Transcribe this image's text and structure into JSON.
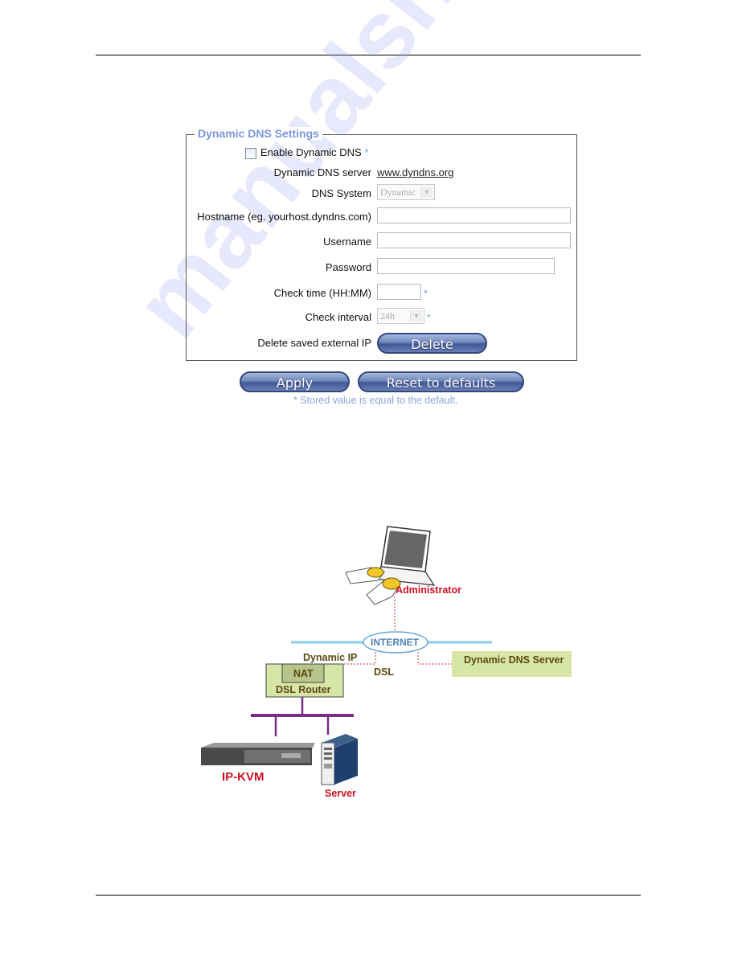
{
  "form": {
    "legend": "Dynamic DNS Settings",
    "enable": {
      "label": "Enable Dynamic DNS",
      "checked": false,
      "marker": "*"
    },
    "server": {
      "label": "Dynamic DNS server",
      "value": "www.dyndns.org"
    },
    "dns_system": {
      "label": "DNS System",
      "selected": "Dynamic",
      "disabled": true
    },
    "hostname": {
      "label": "Hostname (eg. yourhost.dyndns.com)",
      "value": ""
    },
    "username": {
      "label": "Username",
      "value": ""
    },
    "password": {
      "label": "Password",
      "value": ""
    },
    "check_time": {
      "label": "Check time (HH:MM)",
      "value": "",
      "marker": "*"
    },
    "check_interval": {
      "label": "Check interval",
      "selected": "24h",
      "disabled": true,
      "marker": "*"
    },
    "delete_ip": {
      "label": "Delete saved external IP",
      "button": "Delete"
    }
  },
  "actions": {
    "apply": "Apply",
    "reset": "Reset to defaults"
  },
  "note": "* Stored value is equal to the default.",
  "watermark": "manualshive.com",
  "diagram": {
    "administrator": "Administrator",
    "internet": "INTERNET",
    "dynamic_ip": "Dynamic IP",
    "dsl": "DSL",
    "dns_server": "Dynamic DNS Server",
    "nat": "NAT",
    "router": "DSL Router",
    "ipkvm": "IP-KVM",
    "server": "Server",
    "colors": {
      "red_label": "#cc1122",
      "olive_label": "#5a4a10",
      "box_fill": "#d7e6a6",
      "bus": "#7a2d86"
    }
  }
}
